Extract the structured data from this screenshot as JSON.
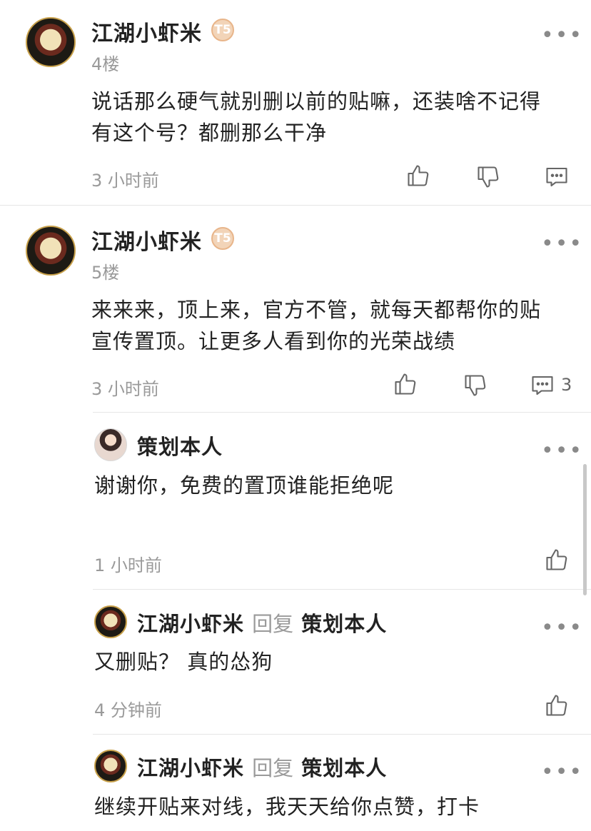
{
  "comments": [
    {
      "username": "江湖小虾米",
      "badge": "T5",
      "floor": "4楼",
      "content_lines": [
        "说话那么硬气就别删以前的贴嘛，还装啥不记得",
        "有这个号？都删那么干净"
      ],
      "time": "3 小时前"
    },
    {
      "username": "江湖小虾米",
      "badge": "T5",
      "floor": "5楼",
      "content_lines": [
        "来来来，顶上来，官方不管，就每天都帮你的贴",
        "宣传置顶。让更多人看到你的光荣战绩"
      ],
      "time": "3 小时前",
      "reply_count": "3"
    }
  ],
  "replies": [
    {
      "username": "策划本人",
      "content": "谢谢你，免费的置顶谁能拒绝呢",
      "time": "1 小时前"
    },
    {
      "username": "江湖小虾米",
      "reply_word": "回复",
      "target": "策划本人",
      "content": "又删贴？ 真的怂狗",
      "time": "4 分钟前"
    },
    {
      "username": "江湖小虾米",
      "reply_word": "回复",
      "target": "策划本人",
      "content": "继续开贴来对线，我天天给你点赞，打卡"
    }
  ],
  "icons": {
    "more": "more-dots-icon",
    "like": "thumbs-up-icon",
    "dislike": "thumbs-down-icon",
    "comment": "comment-bubble-icon"
  },
  "colors": {
    "text_primary": "#222222",
    "text_secondary": "#9a9a9a",
    "badge": "#f2d4b8"
  }
}
